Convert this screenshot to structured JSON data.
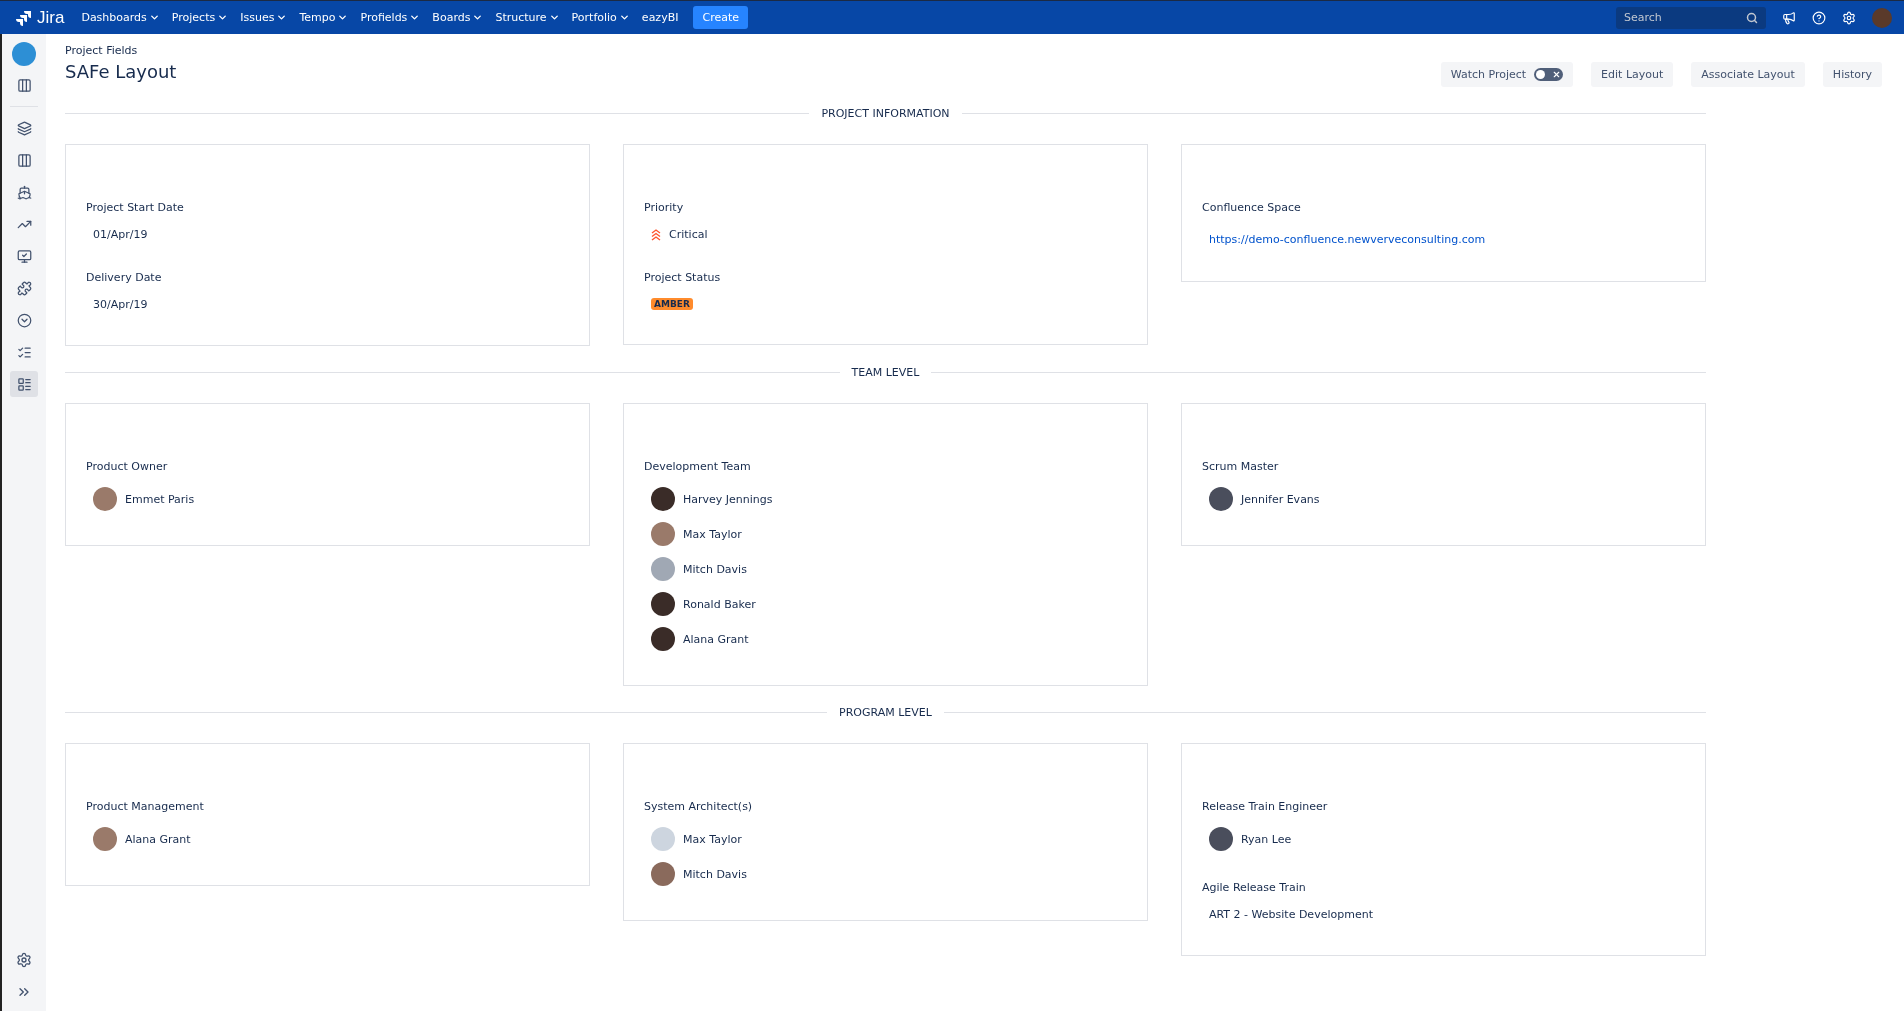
{
  "top_nav": {
    "logo": "Jira",
    "menus": [
      {
        "label": "Dashboards",
        "dropdown": true
      },
      {
        "label": "Projects",
        "dropdown": true
      },
      {
        "label": "Issues",
        "dropdown": true
      },
      {
        "label": "Tempo",
        "dropdown": true
      },
      {
        "label": "Profields",
        "dropdown": true
      },
      {
        "label": "Boards",
        "dropdown": true
      },
      {
        "label": "Structure",
        "dropdown": true
      },
      {
        "label": "Portfolio",
        "dropdown": true
      },
      {
        "label": "eazyBI",
        "dropdown": false
      }
    ],
    "create_button": "Create",
    "search": {
      "placeholder": "Search"
    }
  },
  "sidebar": {
    "items": [
      {
        "kind": "board",
        "selected": false
      },
      {
        "kind": "backlog",
        "selected": false
      },
      {
        "kind": "columns",
        "selected": false
      },
      {
        "kind": "ship",
        "selected": false
      },
      {
        "kind": "chart",
        "selected": false
      },
      {
        "kind": "monitor",
        "selected": false
      },
      {
        "kind": "puzzle",
        "selected": false
      },
      {
        "kind": "clock",
        "selected": false
      },
      {
        "kind": "list",
        "selected": false
      },
      {
        "kind": "fields",
        "selected": true
      }
    ]
  },
  "header": {
    "breadcrumb": "Project Fields",
    "title": "SAFe Layout",
    "watch": {
      "label": "Watch Project",
      "on": false
    },
    "buttons": [
      "Edit Layout",
      "Associate Layout",
      "History"
    ]
  },
  "sections": [
    {
      "title": "PROJECT INFORMATION",
      "cards": [
        {
          "fields": [
            {
              "label": "Project Start Date",
              "kind": "text",
              "value": "01/Apr/19"
            },
            {
              "label": "Delivery Date",
              "kind": "text",
              "value": "30/Apr/19"
            }
          ]
        },
        {
          "fields": [
            {
              "label": "Priority",
              "kind": "priority",
              "value": "Critical"
            },
            {
              "label": "Project Status",
              "kind": "status",
              "value": "AMBER",
              "color": "#ff8b2c"
            }
          ]
        },
        {
          "fields": [
            {
              "label": "Confluence Space",
              "kind": "link",
              "value": "https://demo-confluence.newverveconsulting.com"
            }
          ]
        }
      ]
    },
    {
      "title": "TEAM LEVEL",
      "cards": [
        {
          "fields": [
            {
              "label": "Product Owner",
              "kind": "users",
              "users": [
                "Emmet Paris"
              ]
            }
          ]
        },
        {
          "fields": [
            {
              "label": "Development Team",
              "kind": "users",
              "users": [
                "Harvey Jennings",
                "Max Taylor",
                "Mitch Davis",
                "Ronald Baker",
                "Alana Grant"
              ]
            }
          ]
        },
        {
          "fields": [
            {
              "label": "Scrum Master",
              "kind": "users",
              "users": [
                "Jennifer Evans"
              ]
            }
          ]
        }
      ]
    },
    {
      "title": "PROGRAM LEVEL",
      "cards": [
        {
          "fields": [
            {
              "label": "Product Management",
              "kind": "users",
              "users": [
                "Alana Grant"
              ]
            }
          ]
        },
        {
          "fields": [
            {
              "label": "System Architect(s)",
              "kind": "users",
              "users": [
                "Max Taylor",
                "Mitch Davis"
              ]
            }
          ]
        },
        {
          "fields": [
            {
              "label": "Release Train Engineer",
              "kind": "users",
              "users": [
                "Ryan Lee"
              ]
            },
            {
              "label": "Agile Release Train",
              "kind": "text",
              "value": "ART 2 - Website Development"
            }
          ]
        }
      ]
    }
  ]
}
